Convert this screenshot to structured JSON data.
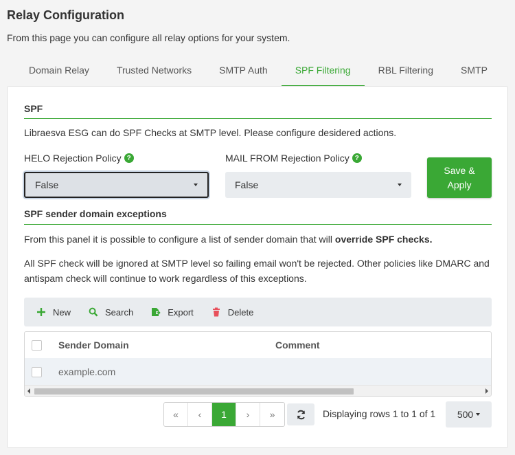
{
  "page": {
    "title": "Relay Configuration",
    "description": "From this page you can configure all relay options for your system."
  },
  "tabs": [
    {
      "label": "Domain Relay",
      "active": false
    },
    {
      "label": "Trusted Networks",
      "active": false
    },
    {
      "label": "SMTP Auth",
      "active": false
    },
    {
      "label": "SPF Filtering",
      "active": true
    },
    {
      "label": "RBL Filtering",
      "active": false
    },
    {
      "label": "SMTP",
      "active": false
    }
  ],
  "spf": {
    "title": "SPF",
    "description": "Libraesva ESG can do SPF Checks at SMTP level. Please configure desidered actions.",
    "helo_label": "HELO Rejection Policy",
    "helo_value": "False",
    "mailfrom_label": "MAIL FROM Rejection Policy",
    "mailfrom_value": "False",
    "save_label": "Save & Apply"
  },
  "exceptions": {
    "title": "SPF sender domain exceptions",
    "desc_prefix": "From this panel it is possible to configure a list of sender domain that will ",
    "desc_bold": "override SPF checks.",
    "note": "All SPF check will be ignored at SMTP level so failing email won't be rejected. Other policies like DMARC and antispam check will continue to work regardless of this exceptions."
  },
  "toolbar": {
    "new_label": "New",
    "search_label": "Search",
    "export_label": "Export",
    "delete_label": "Delete"
  },
  "grid": {
    "columns": [
      "Sender Domain",
      "Comment"
    ],
    "rows": [
      {
        "domain": "example.com",
        "comment": ""
      }
    ]
  },
  "pagination": {
    "first": "«",
    "prev": "‹",
    "current": "1",
    "next": "›",
    "last": "»",
    "rows_text": "Displaying rows 1 to 1 of 1",
    "page_size": "500"
  },
  "colors": {
    "accent": "#3aa835",
    "delete": "#e8505b"
  }
}
